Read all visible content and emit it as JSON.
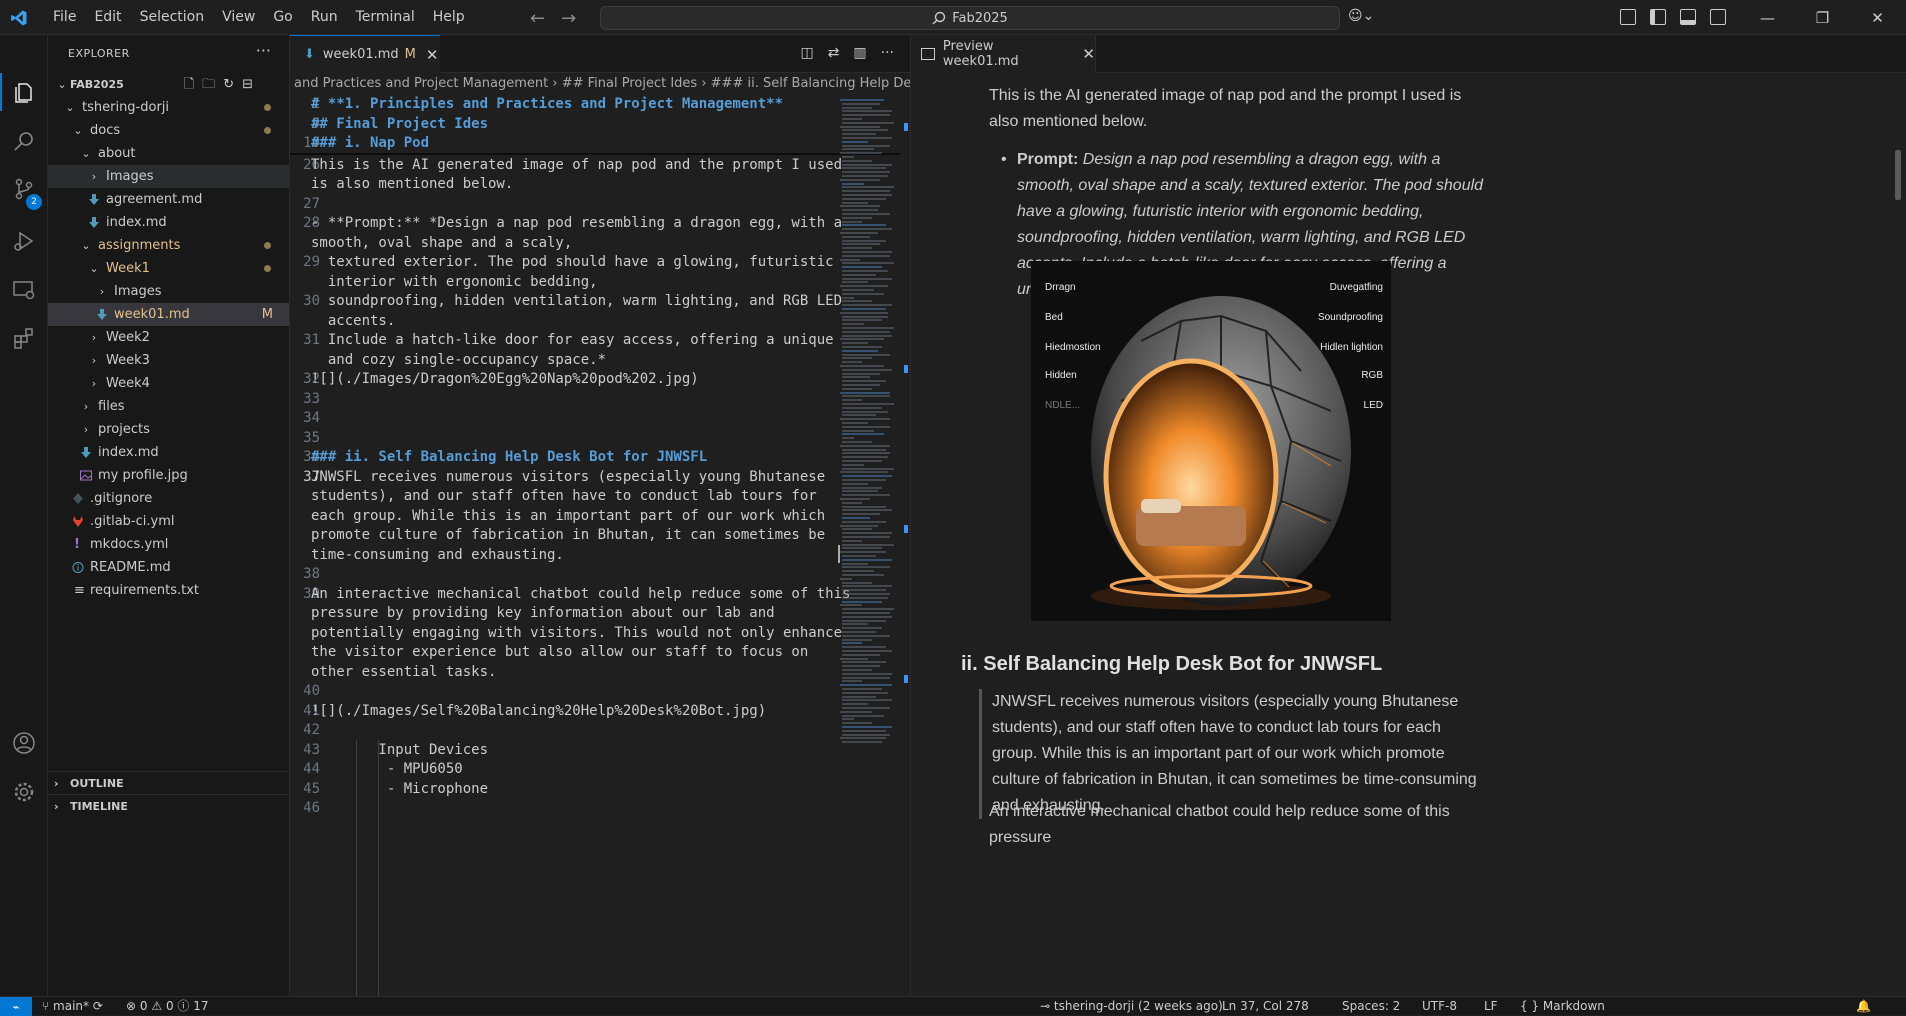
{
  "menu": [
    "File",
    "Edit",
    "Selection",
    "View",
    "Go",
    "Run",
    "Terminal",
    "Help"
  ],
  "search": {
    "label": "Fab2025"
  },
  "sidebar": {
    "title": "EXPLORER",
    "root": "FAB2025",
    "items": [
      {
        "label": "tshering-dorji"
      },
      {
        "label": "docs"
      },
      {
        "label": "about"
      },
      {
        "label": "Images"
      },
      {
        "label": "agreement.md"
      },
      {
        "label": "index.md"
      },
      {
        "label": "assignments"
      },
      {
        "label": "Week1"
      },
      {
        "label": "Images"
      },
      {
        "label": "week01.md",
        "badge": "M"
      },
      {
        "label": "Week2"
      },
      {
        "label": "Week3"
      },
      {
        "label": "Week4"
      },
      {
        "label": "files"
      },
      {
        "label": "projects"
      },
      {
        "label": "index.md"
      },
      {
        "label": "my profile.jpg"
      },
      {
        "label": ".gitignore"
      },
      {
        "label": ".gitlab-ci.yml"
      },
      {
        "label": "mkdocs.yml"
      },
      {
        "label": "README.md"
      },
      {
        "label": "requirements.txt"
      }
    ],
    "outline": "OUTLINE",
    "timeline": "TIMELINE",
    "scm_badge": "2"
  },
  "editor": {
    "tab_label": "week01.md",
    "tab_badge": "M",
    "breadcrumb": "and Practices and Project Management  ›  ## Final Project Ides  ›  ### ii. Self Balancing Help Desk Bot for JN",
    "lines": [
      {
        "n": "1",
        "t": "# **1. Principles and Practices and Project Management**",
        "h": true
      },
      {
        "n": "9",
        "t": "## Final Project Ides",
        "h": true
      },
      {
        "n": "10",
        "t": "### i. Nap Pod",
        "h": true
      },
      {
        "n": "26",
        "t": "This is the AI generated image of nap pod and the prompt I used"
      },
      {
        "n": "",
        "t": "is also mentioned below."
      },
      {
        "n": "27",
        "t": ""
      },
      {
        "n": "28",
        "t": "- **Prompt:** *Design a nap pod resembling a dragon egg, with a"
      },
      {
        "n": "",
        "t": "smooth, oval shape and a scaly,"
      },
      {
        "n": "29",
        "t": "  textured exterior. The pod should have a glowing, futuristic"
      },
      {
        "n": "",
        "t": "  interior with ergonomic bedding,"
      },
      {
        "n": "30",
        "t": "  soundproofing, hidden ventilation, warm lighting, and RGB LED"
      },
      {
        "n": "",
        "t": "  accents."
      },
      {
        "n": "31",
        "t": "  Include a hatch-like door for easy access, offering a unique"
      },
      {
        "n": "",
        "t": "  and cozy single-occupancy space.*"
      },
      {
        "n": "32",
        "t": "![](./Images/Dragon%20Egg%20Nap%20pod%202.jpg)"
      },
      {
        "n": "33",
        "t": ""
      },
      {
        "n": "34",
        "t": ""
      },
      {
        "n": "35",
        "t": ""
      },
      {
        "n": "36",
        "t": "### ii. Self Balancing Help Desk Bot for JNWSFL",
        "h": true
      },
      {
        "n": "37",
        "t": "JNWSFL receives numerous visitors (especially young Bhutanese"
      },
      {
        "n": "",
        "t": "students), and our staff often have to conduct lab tours for"
      },
      {
        "n": "",
        "t": "each group. While this is an important part of our work which"
      },
      {
        "n": "",
        "t": "promote culture of fabrication in Bhutan, it can sometimes be"
      },
      {
        "n": "",
        "t": "time-consuming and exhausting."
      },
      {
        "n": "38",
        "t": ""
      },
      {
        "n": "39",
        "t": "An interactive mechanical chatbot could help reduce some of this"
      },
      {
        "n": "",
        "t": "pressure by providing key information about our lab and"
      },
      {
        "n": "",
        "t": "potentially engaging with visitors. This would not only enhance"
      },
      {
        "n": "",
        "t": "the visitor experience but also allow our staff to focus on"
      },
      {
        "n": "",
        "t": "other essential tasks."
      },
      {
        "n": "40",
        "t": ""
      },
      {
        "n": "41",
        "t": "![](./Images/Self%20Balancing%20Help%20Desk%20Bot.jpg)"
      },
      {
        "n": "42",
        "t": ""
      },
      {
        "n": "43",
        "t": "        Input Devices"
      },
      {
        "n": "44",
        "t": "         - MPU6050"
      },
      {
        "n": "45",
        "t": "         - Microphone"
      },
      {
        "n": "46",
        "t": ""
      }
    ]
  },
  "preview": {
    "tab_label": "Preview week01.md",
    "para1": "This is the AI generated image of nap pod and the prompt I used is also mentioned below.",
    "prompt_label": "Prompt:",
    "prompt_text": "Design a nap pod resembling a dragon egg, with a smooth, oval shape and a scaly, textured exterior. The pod should have a glowing, futuristic interior with ergonomic bedding, soundproofing, hidden ventilation, warm lighting, and RGB LED accents. Include a hatch-like door for easy access, offering a unique and cozy single-occupancy space.",
    "image_labels_left": [
      "Drragn",
      "Bed",
      "Hiedmostion",
      "Hidden",
      "NDLE..."
    ],
    "image_labels_right": [
      "Duvegatfing",
      "Soundproofing",
      "Hidlen lightion",
      "RGB",
      "LED"
    ],
    "heading2": "ii. Self Balancing Help Desk Bot for JNWSFL",
    "para2": "JNWSFL receives numerous visitors (especially young Bhutanese students), and our staff often have to conduct lab tours for each group. While this is an important part of our work which promote culture of fabrication in Bhutan, it can sometimes be time-consuming and exhausting.",
    "para3": "An interactive mechanical chatbot could help reduce some of this pressure"
  },
  "status": {
    "branch": "main*",
    "errors": "0",
    "warnings": "0",
    "info": "17",
    "blame": "tshering-dorji (2 weeks ago)",
    "position": "Ln 37, Col 278",
    "spaces": "Spaces: 2",
    "encoding": "UTF-8",
    "eol": "LF",
    "language": "Markdown",
    "lang_braces": "{ }"
  }
}
